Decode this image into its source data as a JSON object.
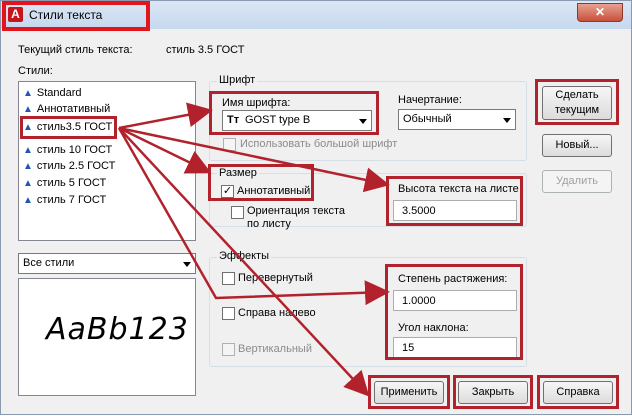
{
  "window": {
    "title": "Стили текста",
    "app_icon": "A",
    "close_symbol": "✕"
  },
  "current_style": {
    "label": "Текущий стиль текста:",
    "value": "стиль 3.5 ГОСТ"
  },
  "styles": {
    "label": "Стили:",
    "items": [
      "Standard",
      "Аннотативный",
      "стиль3.5 ГОСТ",
      "стиль 10  ГОСТ",
      "стиль 2.5 ГОСТ",
      "стиль 5  ГОСТ",
      "стиль 7 ГОСТ"
    ],
    "selected_index": 2,
    "icon": "text-style-icon"
  },
  "filter": {
    "value": "Все стили"
  },
  "preview": {
    "text": "AaBb123"
  },
  "font": {
    "group_label": "Шрифт",
    "name_label": "Имя шрифта:",
    "name_value": "GOST type B",
    "font_icon": "truetype-icon",
    "style_label": "Начертание:",
    "style_value": "Обычный",
    "bigfont_label": "Использовать большой шрифт"
  },
  "size": {
    "group_label": "Размер",
    "annotative_label": "Аннотативный",
    "annotative_checked": true,
    "orientation_label_1": "Ориентация текста",
    "orientation_label_2": "по листу",
    "height_label": "Высота текста на листе",
    "height_value": "3.5000"
  },
  "effects": {
    "group_label": "Эффекты",
    "upside_down_label": "Перевернутый",
    "backwards_label": "Справа налево",
    "vertical_label": "Вертикальный",
    "width_label": "Степень растяжения:",
    "width_value": "1.0000",
    "oblique_label": "Угол наклона:",
    "oblique_value": "15"
  },
  "buttons": {
    "set_current_1": "Сделать",
    "set_current_2": "текущим",
    "new": "Новый...",
    "delete": "Удалить",
    "apply": "Применить",
    "close": "Закрыть",
    "help": "Справка"
  },
  "colors": {
    "highlight": "#b1222c",
    "accent": "#e3151c"
  }
}
